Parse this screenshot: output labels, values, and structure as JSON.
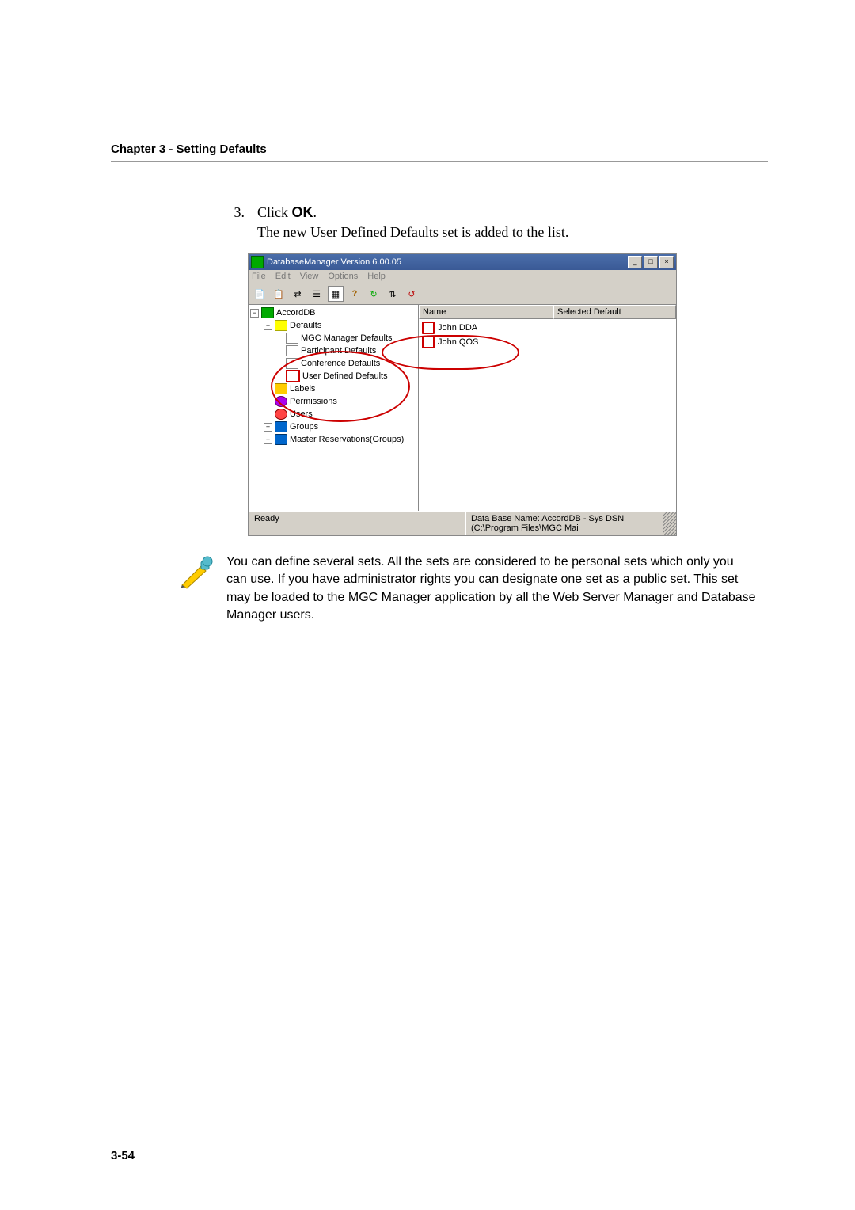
{
  "chapter_header": "Chapter 3 - Setting Defaults",
  "step": {
    "number": "3.",
    "action_prefix": "Click ",
    "action_bold": "OK",
    "action_suffix": ".",
    "result": "The new User Defined Defaults set is added to the list."
  },
  "screenshot": {
    "title": "DatabaseManager Version 6.00.05",
    "menu": [
      "File",
      "Edit",
      "View",
      "Options",
      "Help"
    ],
    "toolbar_icons": [
      "copy-icon",
      "paste-icon",
      "network-icon",
      "list-icon",
      "grid-icon",
      "help-icon",
      "refresh-green-icon",
      "sync-icon",
      "refresh-red-icon"
    ],
    "tree": {
      "root": "AccordDB",
      "defaults": {
        "label": "Defaults",
        "children": [
          "MGC Manager Defaults",
          "Participant Defaults",
          "Conference Defaults",
          "User Defined Defaults"
        ]
      },
      "siblings": [
        "Labels",
        "Permissions",
        "Users",
        "Groups",
        "Master Reservations(Groups)"
      ]
    },
    "list": {
      "columns": [
        "Name",
        "Selected Default"
      ],
      "rows": [
        {
          "name": "John DDA"
        },
        {
          "name": "John QOS"
        }
      ]
    },
    "status_left": "Ready",
    "status_right": "Data Base Name: AccordDB - Sys DSN (C:\\Program Files\\MGC Mai",
    "winbuttons": {
      "min": "_",
      "max": "□",
      "close": "×"
    }
  },
  "note": "You can define several sets. All the sets are considered to be personal sets which only you can use. If you have administrator rights you can designate one set as a public set. This set may be loaded to the MGC Manager application by all the Web Server Manager and Database Manager users.",
  "page_number": "3-54"
}
